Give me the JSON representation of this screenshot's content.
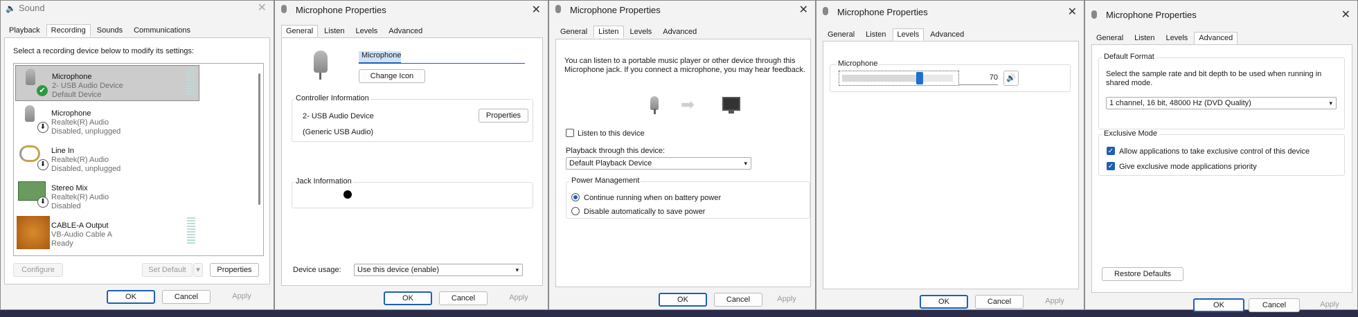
{
  "sound": {
    "title": "Sound",
    "tabs": [
      "Playback",
      "Recording",
      "Sounds",
      "Communications"
    ],
    "instruction": "Select a recording device below to modify its settings:",
    "devices": [
      {
        "name": "Microphone",
        "line1": "2- USB Audio Device",
        "line2": "Default Device",
        "status_icon": "check-icon"
      },
      {
        "name": "Microphone",
        "line1": "Realtek(R) Audio",
        "line2": "Disabled, unplugged",
        "status_icon": "down-arrow-icon"
      },
      {
        "name": "Line In",
        "line1": "Realtek(R) Audio",
        "line2": "Disabled, unplugged",
        "status_icon": "down-arrow-icon"
      },
      {
        "name": "Stereo Mix",
        "line1": "Realtek(R) Audio",
        "line2": "Disabled",
        "status_icon": "down-arrow-icon"
      },
      {
        "name": "CABLE-A Output",
        "line1": "VB-Audio Cable A",
        "line2": "Ready",
        "status_icon": ""
      }
    ],
    "configure": "Configure",
    "set_default": "Set Default",
    "properties": "Properties",
    "ok": "OK",
    "cancel": "Cancel",
    "apply": "Apply"
  },
  "general": {
    "title": "Microphone Properties",
    "tabs": [
      "General",
      "Listen",
      "Levels",
      "Advanced"
    ],
    "name_value": "Microphone",
    "change_icon": "Change Icon",
    "controller_label": "Controller Information",
    "controller_line1": "2- USB Audio Device",
    "controller_line2": "(Generic USB Audio)",
    "properties": "Properties",
    "jack_label": "Jack Information",
    "usage_label": "Device usage:",
    "usage_value": "Use this device (enable)",
    "ok": "OK",
    "cancel": "Cancel",
    "apply": "Apply"
  },
  "listen": {
    "title": "Microphone Properties",
    "tabs": [
      "General",
      "Listen",
      "Levels",
      "Advanced"
    ],
    "desc": "You can listen to a portable music player or other device through this Microphone jack.  If you connect a microphone, you may hear feedback.",
    "listen_checkbox": "Listen to this device",
    "listen_checked": false,
    "playback_label": "Playback through this device:",
    "playback_value": "Default Playback Device",
    "power_label": "Power Management",
    "radio1": "Continue running when on battery power",
    "radio2": "Disable automatically to save power",
    "ok": "OK",
    "cancel": "Cancel",
    "apply": "Apply"
  },
  "levels": {
    "title": "Microphone Properties",
    "tabs": [
      "General",
      "Listen",
      "Levels",
      "Advanced"
    ],
    "group_label": "Microphone",
    "level": 70,
    "level_text": "70",
    "ok": "OK",
    "cancel": "Cancel",
    "apply": "Apply"
  },
  "advanced": {
    "title": "Microphone Properties",
    "tabs": [
      "General",
      "Listen",
      "Levels",
      "Advanced"
    ],
    "default_format_label": "Default Format",
    "default_format_desc": "Select the sample rate and bit depth to be used when running in shared mode.",
    "format_value": "1 channel, 16 bit, 48000 Hz (DVD Quality)",
    "exclusive_label": "Exclusive Mode",
    "exclusive1": "Allow applications to take exclusive control of this device",
    "exclusive2": "Give exclusive mode applications priority",
    "restore": "Restore Defaults",
    "ok": "OK",
    "cancel": "Cancel",
    "apply": "Apply"
  },
  "colors": {
    "accent": "#1d5fb6",
    "selected_row": "#cccccc",
    "meter": "#bcd9d7"
  }
}
